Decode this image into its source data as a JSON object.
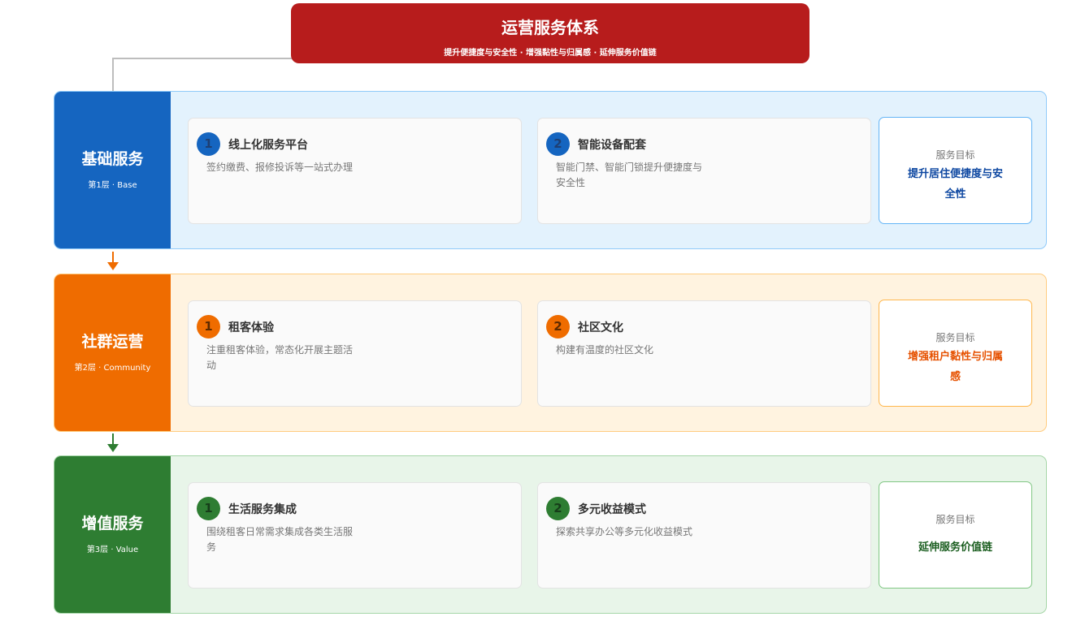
{
  "header": {
    "title": "运营服务体系",
    "subtitle": "提升便捷度与安全性 · 增强黏性与归属感 · 延伸服务价值链"
  },
  "colors": {
    "header": "#b71c1c",
    "base": "#1565c0",
    "community": "#ef6c00",
    "value": "#2e7d32"
  },
  "layers": [
    {
      "name": "基础服务",
      "tag": "第1层 · Base",
      "cards": [
        {
          "num": "1",
          "title": "线上化服务平台",
          "desc": "签约缴费、报修投诉等一站式办理"
        },
        {
          "num": "2",
          "title": "智能设备配套",
          "desc": "智能门禁、智能门锁提升便捷度与安全性"
        }
      ],
      "goal_label": "服务目标",
      "goal_value": "提升居住便捷度与安全性"
    },
    {
      "name": "社群运营",
      "tag": "第2层 · Community",
      "cards": [
        {
          "num": "1",
          "title": "租客体验",
          "desc": "注重租客体验，常态化开展主题活动"
        },
        {
          "num": "2",
          "title": "社区文化",
          "desc": "构建有温度的社区文化"
        }
      ],
      "goal_label": "服务目标",
      "goal_value": "增强租户黏性与归属感"
    },
    {
      "name": "增值服务",
      "tag": "第3层 · Value",
      "cards": [
        {
          "num": "1",
          "title": "生活服务集成",
          "desc": "围绕租客日常需求集成各类生活服务"
        },
        {
          "num": "2",
          "title": "多元收益模式",
          "desc": "探索共享办公等多元化收益模式"
        }
      ],
      "goal_label": "服务目标",
      "goal_value": "延伸服务价值链"
    }
  ]
}
